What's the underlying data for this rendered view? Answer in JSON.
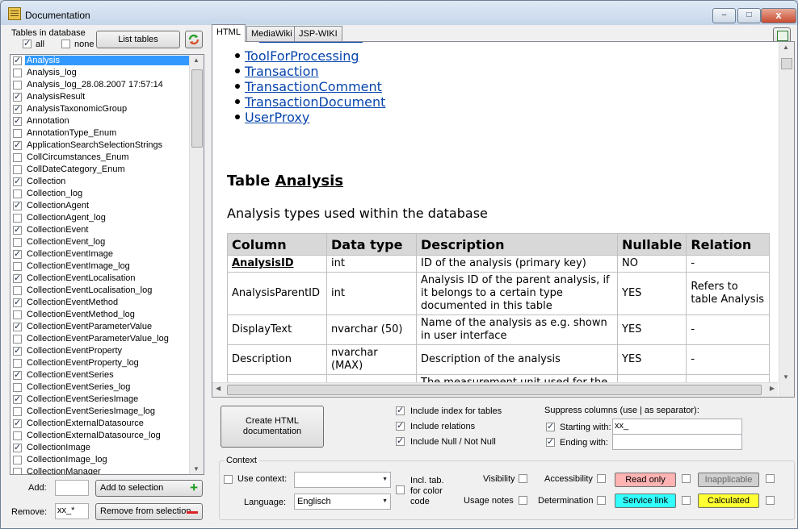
{
  "window": {
    "title": "Documentation",
    "min": "–",
    "max": "□",
    "close": "x"
  },
  "left": {
    "tables_label": "Tables in database",
    "all_label": "all",
    "none_label": "none",
    "list_tables_btn": "List tables",
    "add_label": "Add:",
    "add_value": "",
    "add_btn": "Add to selection",
    "remove_label": "Remove:",
    "remove_value": "xx_*",
    "remove_btn": "Remove from selection",
    "items": [
      {
        "label": "Analysis",
        "checked": true,
        "selected": true
      },
      {
        "label": "Analysis_log",
        "checked": false
      },
      {
        "label": "Analysis_log_28.08.2007 17:57:14",
        "checked": false
      },
      {
        "label": "AnalysisResult",
        "checked": true
      },
      {
        "label": "AnalysisTaxonomicGroup",
        "checked": true
      },
      {
        "label": "Annotation",
        "checked": true
      },
      {
        "label": "AnnotationType_Enum",
        "checked": false
      },
      {
        "label": "ApplicationSearchSelectionStrings",
        "checked": true
      },
      {
        "label": "CollCircumstances_Enum",
        "checked": false
      },
      {
        "label": "CollDateCategory_Enum",
        "checked": false
      },
      {
        "label": "Collection",
        "checked": true
      },
      {
        "label": "Collection_log",
        "checked": false
      },
      {
        "label": "CollectionAgent",
        "checked": true
      },
      {
        "label": "CollectionAgent_log",
        "checked": false
      },
      {
        "label": "CollectionEvent",
        "checked": true
      },
      {
        "label": "CollectionEvent_log",
        "checked": false
      },
      {
        "label": "CollectionEventImage",
        "checked": true
      },
      {
        "label": "CollectionEventImage_log",
        "checked": false
      },
      {
        "label": "CollectionEventLocalisation",
        "checked": true
      },
      {
        "label": "CollectionEventLocalisation_log",
        "checked": false
      },
      {
        "label": "CollectionEventMethod",
        "checked": true
      },
      {
        "label": "CollectionEventMethod_log",
        "checked": false
      },
      {
        "label": "CollectionEventParameterValue",
        "checked": true
      },
      {
        "label": "CollectionEventParameterValue_log",
        "checked": false
      },
      {
        "label": "CollectionEventProperty",
        "checked": true
      },
      {
        "label": "CollectionEventProperty_log",
        "checked": false
      },
      {
        "label": "CollectionEventSeries",
        "checked": true
      },
      {
        "label": "CollectionEventSeries_log",
        "checked": false
      },
      {
        "label": "CollectionEventSeriesImage",
        "checked": true
      },
      {
        "label": "CollectionEventSeriesImage_log",
        "checked": false
      },
      {
        "label": "CollectionExternalDatasource",
        "checked": true
      },
      {
        "label": "CollectionExternalDatasource_log",
        "checked": false
      },
      {
        "label": "CollectionImage",
        "checked": true
      },
      {
        "label": "CollectionImage_log",
        "checked": false
      },
      {
        "label": "CollectionManager",
        "checked": false
      }
    ]
  },
  "tabs": [
    {
      "label": "HTML",
      "active": true
    },
    {
      "label": "MediaWiki",
      "active": false
    },
    {
      "label": "JSP-WIKI",
      "active": false
    }
  ],
  "doc": {
    "links": [
      "ToolForProcessing",
      "Transaction",
      "TransactionComment",
      "TransactionDocument",
      "UserProxy"
    ],
    "heading_prefix": "Table ",
    "heading_name": "Analysis",
    "lead": "Analysis types used within the database",
    "columns": [
      "Column",
      "Data type",
      "Description",
      "Nullable",
      "Relation"
    ],
    "rows": [
      {
        "column": "AnalysisID",
        "type": "int",
        "desc": "ID of the analysis (primary key)",
        "nullable": "NO",
        "relation": "-"
      },
      {
        "column": "AnalysisParentID",
        "type": "int",
        "desc": "Analysis ID of the parent analysis, if it belongs to a certain type documented in this table",
        "nullable": "YES",
        "relation": "Refers to table Analysis"
      },
      {
        "column": "DisplayText",
        "type": "nvarchar (50)",
        "desc": "Name of the analysis as e.g. shown in user interface",
        "nullable": "YES",
        "relation": "-"
      },
      {
        "column": "Description",
        "type": "nvarchar (MAX)",
        "desc": "Description of the analysis",
        "nullable": "YES",
        "relation": "-"
      },
      {
        "column": "",
        "type": "",
        "desc": "The measurement unit used for the",
        "nullable": "",
        "relation": ""
      }
    ]
  },
  "options": {
    "create_btn": "Create HTML documentation",
    "include_index": "Include index for tables",
    "include_relations": "Include relations",
    "include_null": "Include Null / Not Null",
    "suppress_label": "Suppress columns (use | as separator):",
    "starting_label": "Starting with:",
    "starting_value": "xx_",
    "ending_label": "Ending with:",
    "ending_value": ""
  },
  "context": {
    "legend": "Context",
    "use_context": "Use context:",
    "context_value": "",
    "language_label": "Language:",
    "language_value": "Englisch",
    "incl_tab": "Incl. tab. for color code",
    "visibility": "Visibility",
    "usage_notes": "Usage notes",
    "accessibility": "Accessibility",
    "determination": "Determination",
    "read_only": "Read only",
    "service_link": "Service link",
    "inapplicable": "Inapplicable",
    "calculated": "Calculated"
  },
  "colors": {
    "read_only": "#ffb3b3",
    "service_link": "#33ffff",
    "inapplicable": "#d0d0d0",
    "calculated": "#ffff33",
    "selection": "#3399ff",
    "link": "#0645ad"
  }
}
